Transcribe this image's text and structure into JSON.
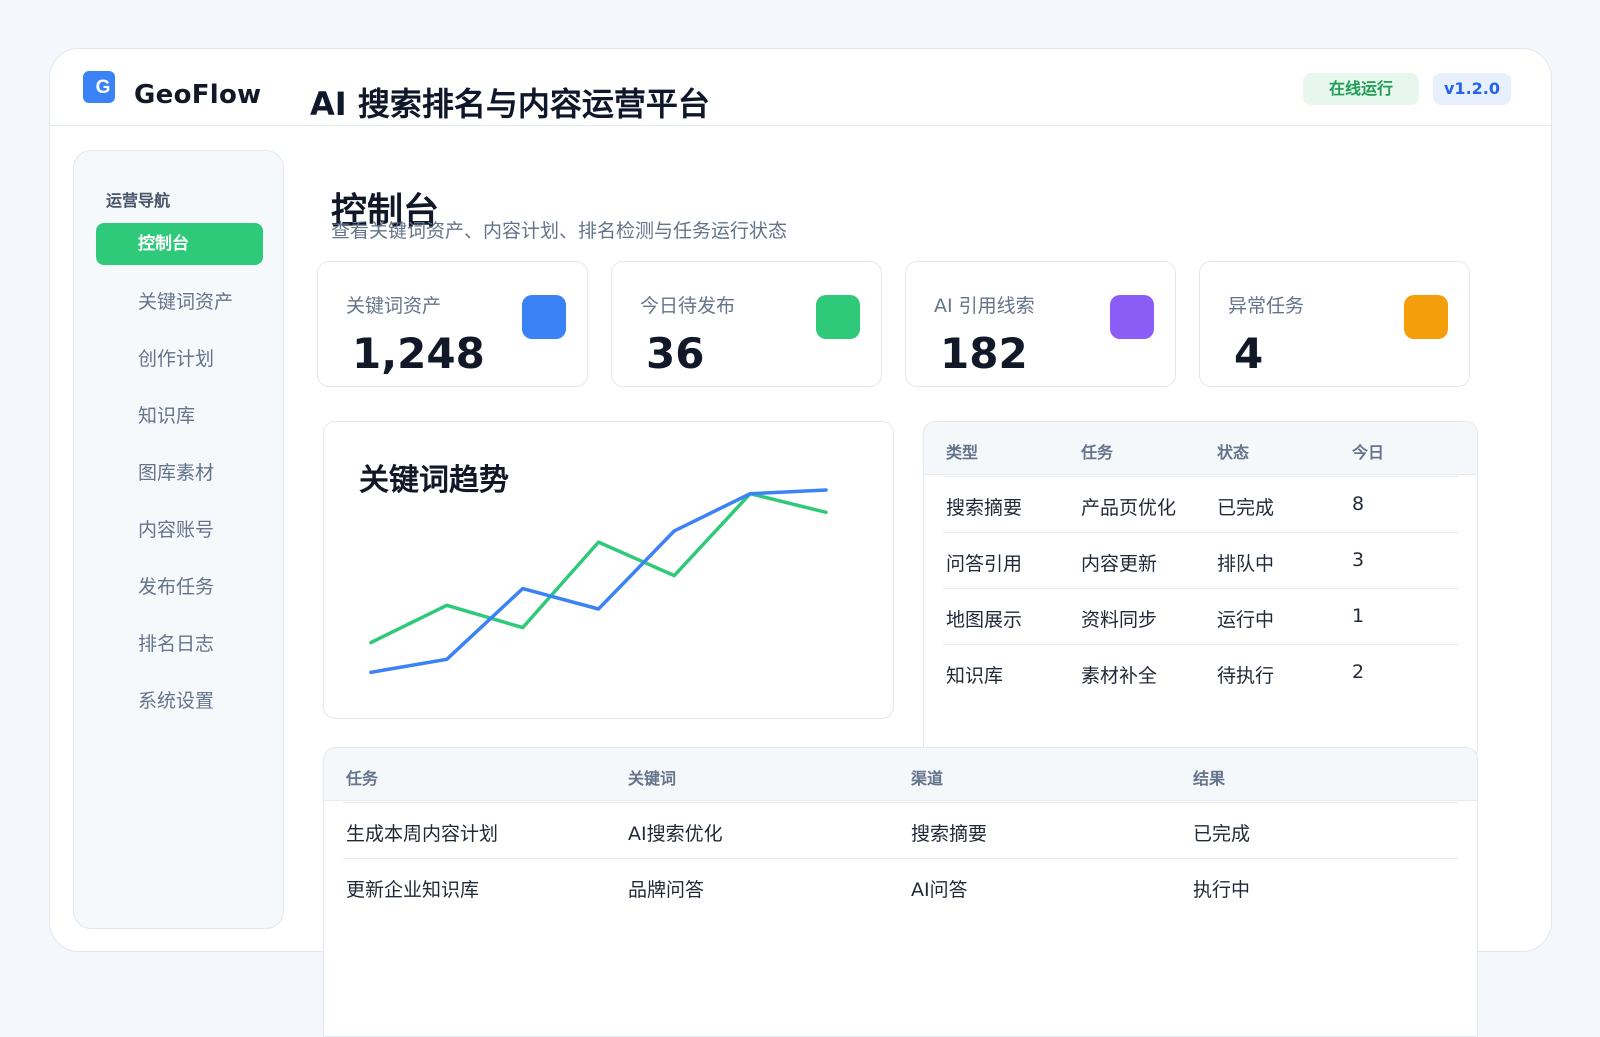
{
  "header": {
    "logo_letter": "G",
    "brand": "GeoFlow",
    "title": "AI 搜索排名与内容运营平台",
    "status_badge": "在线运行",
    "version_badge": "v1.2.0"
  },
  "sidebar": {
    "heading": "运营导航",
    "items": [
      {
        "label": "控制台",
        "active": true
      },
      {
        "label": "关键词资产",
        "active": false
      },
      {
        "label": "创作计划",
        "active": false
      },
      {
        "label": "知识库",
        "active": false
      },
      {
        "label": "图库素材",
        "active": false
      },
      {
        "label": "内容账号",
        "active": false
      },
      {
        "label": "发布任务",
        "active": false
      },
      {
        "label": "排名日志",
        "active": false
      },
      {
        "label": "系统设置",
        "active": false
      }
    ]
  },
  "page": {
    "title": "控制台",
    "subtitle": "查看关键词资产、内容计划、排名检测与任务运行状态"
  },
  "stats": [
    {
      "label": "关键词资产",
      "value": "1,248",
      "color": "#3b82f6"
    },
    {
      "label": "今日待发布",
      "value": "36",
      "color": "#2fc97a"
    },
    {
      "label": "AI 引用线索",
      "value": "182",
      "color": "#8b5cf6"
    },
    {
      "label": "异常任务",
      "value": "4",
      "color": "#f59e0b"
    }
  ],
  "trend": {
    "title": "关键词趋势"
  },
  "chart_data": {
    "type": "line",
    "title": "关键词趋势",
    "x": [
      1,
      2,
      3,
      4,
      5,
      6,
      7
    ],
    "ylim": [
      0,
      100
    ],
    "grid": false,
    "legend": "none",
    "series": [
      {
        "color": "#2fc97a",
        "values": [
          18,
          38,
          26,
          72,
          54,
          98,
          88
        ]
      },
      {
        "color": "#3b82f6",
        "values": [
          2,
          9,
          47,
          36,
          78,
          98,
          100
        ]
      }
    ]
  },
  "task_table": {
    "headers": [
      "类型",
      "任务",
      "状态",
      "今日"
    ],
    "rows": [
      [
        "搜索摘要",
        "产品页优化",
        "已完成",
        "8"
      ],
      [
        "问答引用",
        "内容更新",
        "排队中",
        "3"
      ],
      [
        "地图展示",
        "资料同步",
        "运行中",
        "1"
      ],
      [
        "知识库",
        "素材补全",
        "待执行",
        "2"
      ]
    ]
  },
  "job_table": {
    "headers": [
      "任务",
      "关键词",
      "渠道",
      "结果"
    ],
    "rows": [
      [
        "生成本周内容计划",
        "AI搜索优化",
        "搜索摘要",
        "已完成"
      ],
      [
        "更新企业知识库",
        "品牌问答",
        "AI问答",
        "执行中"
      ]
    ]
  }
}
